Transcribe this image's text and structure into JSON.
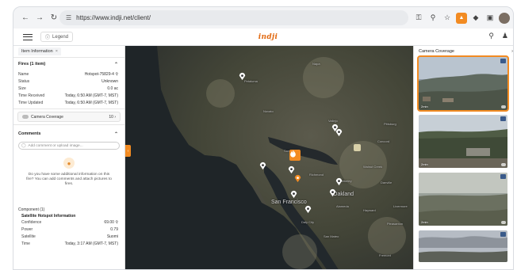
{
  "browser": {
    "url": "https://www.indji.net/client/",
    "icons": [
      "back-icon",
      "forward-icon",
      "reload-icon",
      "site-info-icon",
      "key-icon",
      "zoom-icon",
      "star-icon",
      "extension-icon",
      "puzzle-icon",
      "sidebar-icon",
      "profile-avatar"
    ]
  },
  "app": {
    "legend_label": "Legend",
    "logo_text": "indji"
  },
  "left_panel": {
    "tab_label": "Item Information",
    "tab_close": "×",
    "fires_heading": "Fires (1 item)",
    "fire_rows": [
      {
        "label": "Name",
        "value": "Hotspot-75829-4"
      },
      {
        "label": "Status",
        "value": "Unknown"
      },
      {
        "label": "Size",
        "value": "0.0 ac"
      },
      {
        "label": "Time Received",
        "value": "Today, 6:50 AM (GMT-7, MST)"
      },
      {
        "label": "Time Updated",
        "value": "Today, 6:50 AM (GMT-7, MST)"
      }
    ],
    "camera_coverage_label": "Camera Coverage",
    "camera_coverage_count": "10",
    "comments_heading": "Comments",
    "comment_placeholder": "Add comment or upload image...",
    "empty_text": "Do you have some additional information on this fire? You can add comments and attach pictures to fires.",
    "component_heading": "Component (1)",
    "component_sub": "Satellite Hotspot Information",
    "component_rows": [
      {
        "label": "Confidence",
        "value": "69.00"
      },
      {
        "label": "Power",
        "value": "0.79"
      },
      {
        "label": "Satellite",
        "value": "Suomi"
      },
      {
        "label": "Time",
        "value": "Today, 3:17 AM (GMT-7, MST)"
      }
    ]
  },
  "map": {
    "labels": [
      "San Francisco",
      "Oakland",
      "Daly City",
      "San Rafael",
      "Walnut Creek",
      "Concord",
      "Vallejo",
      "Richmond",
      "Hayward",
      "San Mateo",
      "Fremont",
      "Napa",
      "Petaluma",
      "Novato",
      "Livermore",
      "Danville",
      "Pleasanton",
      "Berkeley",
      "Alameda",
      "Pittsburg"
    ]
  },
  "right_panel": {
    "heading": "Camera Coverage",
    "cameras": [
      {
        "time": "2min",
        "selected": true
      },
      {
        "time": "2min",
        "selected": false
      },
      {
        "time": "2min",
        "selected": false
      },
      {
        "time": "",
        "selected": false
      }
    ]
  }
}
